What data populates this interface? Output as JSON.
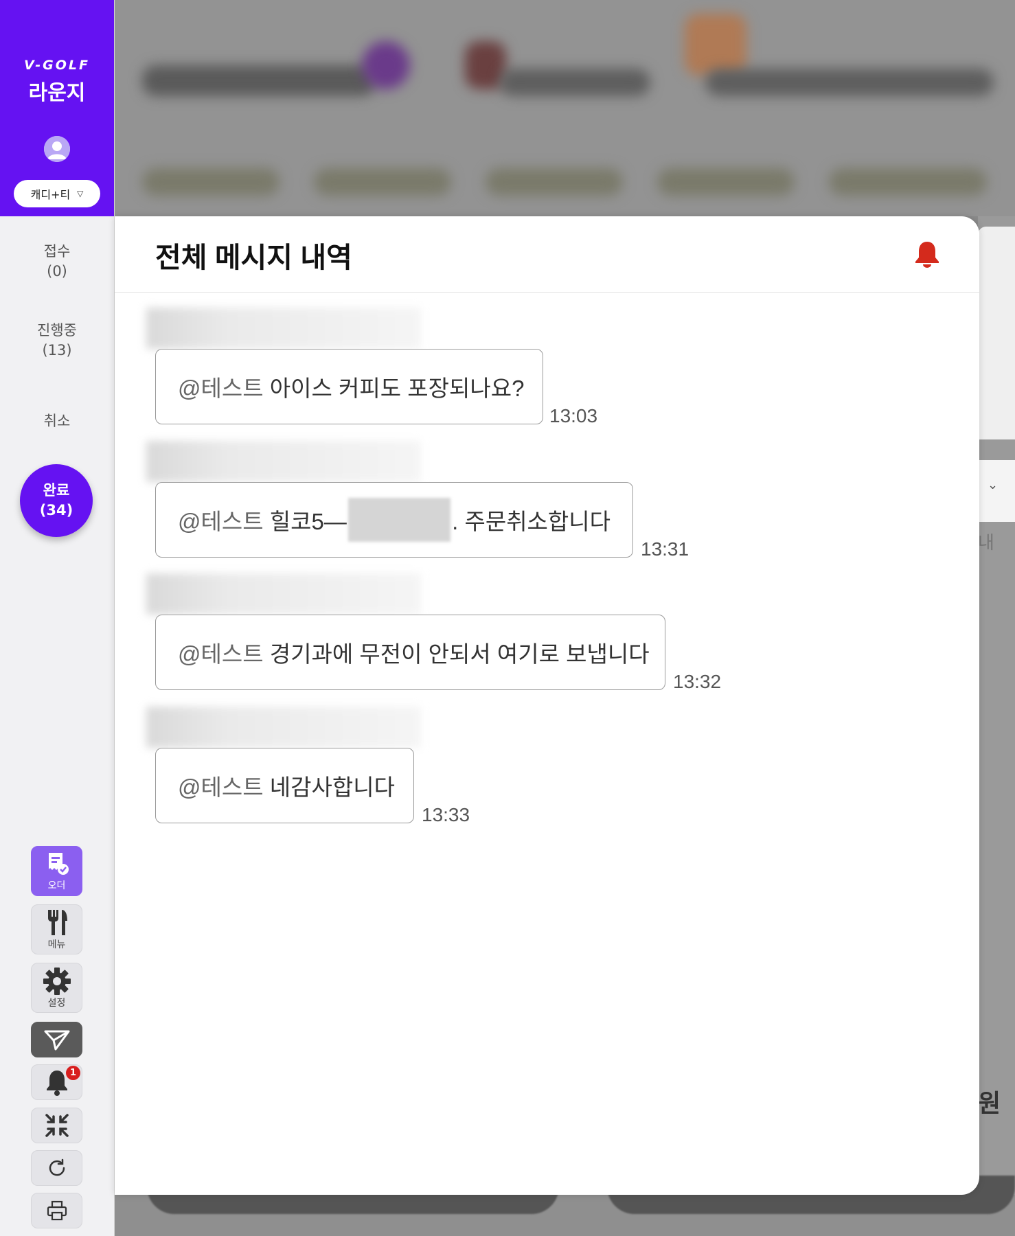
{
  "sidebar": {
    "brand_golf": "V-GOLF",
    "brand_lounge": "라운지",
    "store_select": "캐디+티",
    "nav": {
      "reception_label": "접수",
      "reception_count": "(0)",
      "progress_label": "진행중",
      "progress_count": "(13)",
      "cancel_label": "취소",
      "complete_label": "완료",
      "complete_count": "(34)"
    },
    "tools": {
      "order_label": "오더",
      "menu_label": "메뉴",
      "settings_label": "설정",
      "bell_badge": "1"
    },
    "colors": {
      "brand": "#6512f2",
      "badge": "#d81e1e"
    }
  },
  "modal": {
    "title": "전체 메시지 내역",
    "messages": [
      {
        "mention": "@테스트",
        "text": "아이스 커피도 포장되나요?",
        "time": "13:03"
      },
      {
        "mention": "@테스트",
        "text_before": "힐코5—",
        "text_after": ". 주문취소합니다",
        "time": "13:31"
      },
      {
        "mention": "@테스트",
        "text": "경기과에 무전이 안되서 여기로 보냅니다",
        "time": "13:32"
      },
      {
        "mention": "@테스트",
        "text": "네감사합니다",
        "time": "13:33"
      }
    ]
  },
  "background": {
    "right_char_1": "내",
    "right_char_2": "원"
  }
}
